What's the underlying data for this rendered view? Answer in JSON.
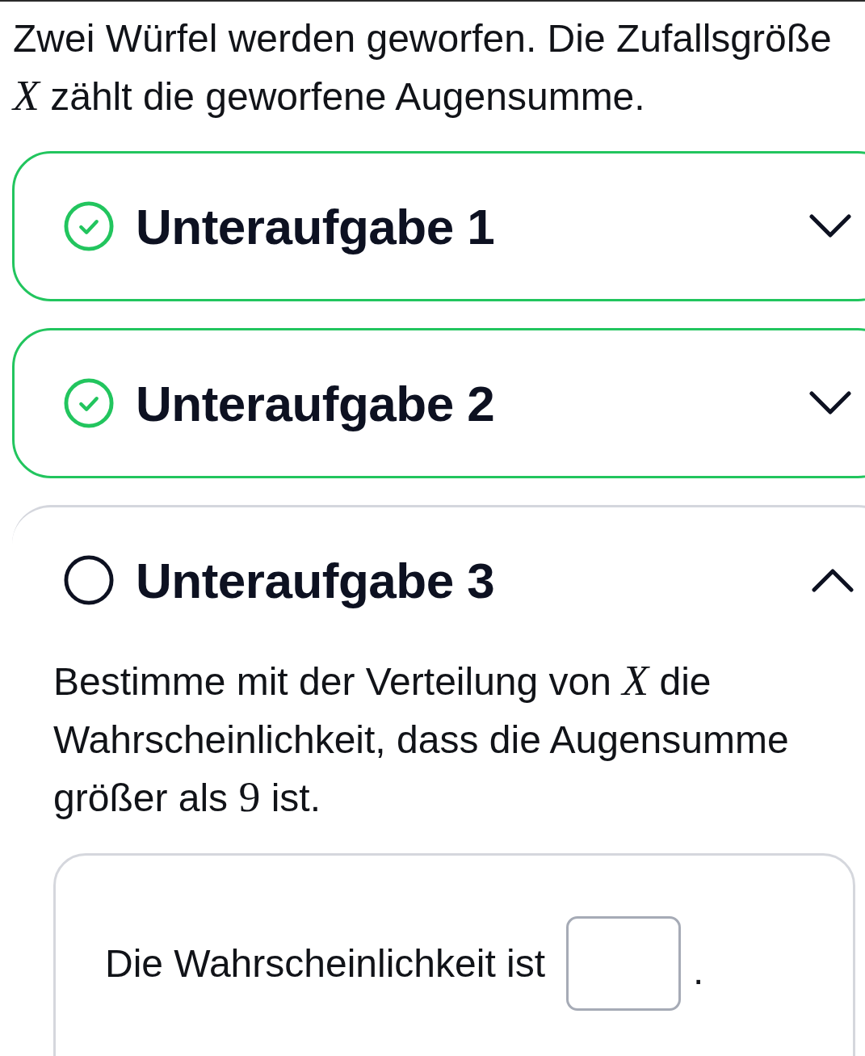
{
  "intro": {
    "segments": [
      {
        "kind": "text",
        "text": "Zwei Würfel werden geworfen. Die Zufallsgröße"
      },
      {
        "kind": "variable",
        "text": "X"
      },
      {
        "kind": "text",
        "text": "zählt die geworfene Augensumme."
      }
    ]
  },
  "subtasks": [
    {
      "title": "Unteraufgabe 1",
      "completed": true,
      "expanded": false
    },
    {
      "title": "Unteraufgabe 2",
      "completed": true,
      "expanded": false
    },
    {
      "title": "Unteraufgabe 3",
      "completed": false,
      "expanded": true,
      "task": {
        "segments": [
          {
            "kind": "text",
            "text": "Bestimme mit der Verteilung von"
          },
          {
            "kind": "variable",
            "text": "X"
          },
          {
            "kind": "text",
            "text": "die Wahrscheinlichkeit, dass die Augensumme größer als"
          },
          {
            "kind": "number",
            "text": "9"
          },
          {
            "kind": "text",
            "text": "ist."
          }
        ]
      },
      "answer": {
        "prompt": "Die Wahrscheinlichkeit ist",
        "suffix": "."
      }
    }
  ]
}
